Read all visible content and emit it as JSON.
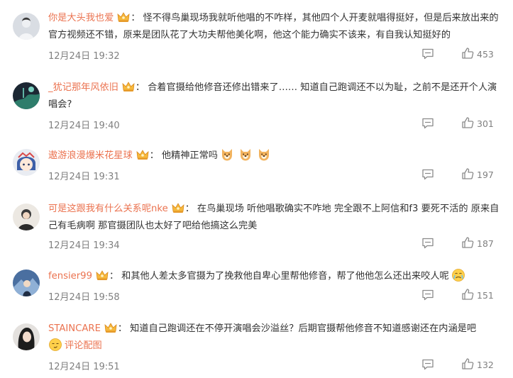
{
  "comments": [
    {
      "user": "你是大头我也爱",
      "separator": "：",
      "text": "怪不得鸟巢现场我就听他唱的不咋样，其他四个人开麦就唱得挺好，但是后来放出来的官方视频还不错，原来是团队花了大功夫帮他美化啊，他这个能力确实不该来，有自我认知挺好的",
      "time": "12月24日 19:32",
      "likes": "453"
    },
    {
      "user": "_犹记那年风依旧",
      "separator": "：",
      "text": "合着官摄给他修音还修出错来了…… 知道自己跑调还不以为耻，之前不是还开个人演唱会?",
      "time": "12月24日 19:40",
      "likes": "301"
    },
    {
      "user": "遨游浪漫爆米花星球",
      "separator": "：",
      "text": "他精神正常吗",
      "time": "12月24日 19:31",
      "likes": "197"
    },
    {
      "user": "可是这跟我有什么关系呢nke",
      "separator": "：",
      "text": "在鸟巢现场 听他唱歌确实不咋地 完全跟不上阿信和f3 要死不活的 原来自己有毛病啊 那官摄团队也太好了吧给他搞这么完美",
      "time": "12月24日 19:34",
      "likes": "187"
    },
    {
      "user": "fensier99",
      "separator": "：",
      "text": "和其他人差太多官摄为了挽救他自卑心里帮他修音，帮了他他怎么还出来咬人呢",
      "time": "12月24日 19:58",
      "likes": "151"
    },
    {
      "user": "STAINCARE",
      "separator": "：",
      "text": "知道自己跑调还在不停开演唱会沙溢丝？后期官摄帮他修音不知道感谢还在内涵是吧",
      "pic_label": "评论配图",
      "time": "12月24日 19:51",
      "likes": "132"
    }
  ],
  "icons": {
    "badge": "crown-badge-icon",
    "reply": "comment-icon",
    "like": "thumbs-up-icon",
    "emoji_dog": "dog-face-emoji",
    "emoji_cry": "cry-emoji",
    "emoji_pic": "picture-emoji"
  },
  "colors": {
    "accent": "#eb7350",
    "meta": "#808080",
    "text": "#333333"
  }
}
